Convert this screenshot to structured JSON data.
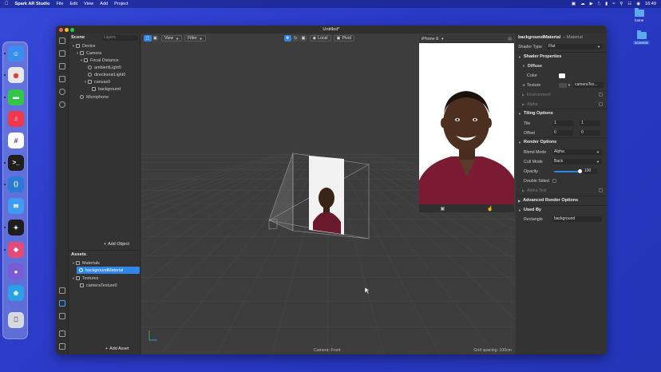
{
  "menubar": {
    "app_name": "Spark AR Studio",
    "menus": [
      "File",
      "Edit",
      "View",
      "Add",
      "Project"
    ],
    "clock": "16:49"
  },
  "desktop": {
    "icons": [
      {
        "label": "home"
      },
      {
        "label": "screenie"
      }
    ]
  },
  "dock": {
    "apps": [
      {
        "icon": "finder-icon",
        "color": "#3a8ef0"
      },
      {
        "icon": "chrome-icon",
        "color": "#e9e9e9"
      },
      {
        "icon": "messages-icon",
        "color": "#33c748"
      },
      {
        "icon": "music-icon",
        "color": "#f2384d"
      },
      {
        "icon": "slack-icon",
        "color": "#ffffff"
      },
      {
        "icon": "terminal-icon",
        "color": "#1e1e1e"
      },
      {
        "icon": "vscode-icon",
        "color": "#2a7bd6"
      },
      {
        "icon": "mail-icon",
        "color": "#3d9bf3"
      },
      {
        "icon": "figma-icon",
        "color": "#1e1e1e"
      },
      {
        "icon": "spark-icon",
        "color": "#e64a7a"
      },
      {
        "icon": "marble-icon",
        "color": "#7b5cd6"
      },
      {
        "icon": "bird-icon",
        "color": "#2aa0e8"
      },
      {
        "icon": "trash-icon",
        "color": "#d6d9e2"
      }
    ]
  },
  "window": {
    "title": "Untitled*",
    "traffic_colors": [
      "#ff5f57",
      "#febc2e",
      "#28c840"
    ]
  },
  "scene": {
    "header": "Scene",
    "search_placeholder": "Layers",
    "tree": [
      {
        "label": "Device",
        "depth": 0
      },
      {
        "label": "Camera",
        "depth": 1
      },
      {
        "label": "Focal Distance",
        "depth": 2
      },
      {
        "label": "ambientLight0",
        "depth": 3
      },
      {
        "label": "directionalLight0",
        "depth": 3
      },
      {
        "label": "canvas0",
        "depth": 3
      },
      {
        "label": "background",
        "depth": 4
      },
      {
        "label": "Microphone",
        "depth": 1
      }
    ],
    "add_object": "Add Object"
  },
  "assets": {
    "header": "Assets",
    "tree": [
      {
        "label": "Materials",
        "depth": 0
      },
      {
        "label": "backgroundMaterial",
        "depth": 1,
        "selected": true
      },
      {
        "label": "Textures",
        "depth": 0
      },
      {
        "label": "cameraTexture0",
        "depth": 1
      }
    ],
    "add_asset": "Add Asset"
  },
  "viewport": {
    "view_label": "View",
    "filter_label": "Filter",
    "local_label": "Local",
    "pivot_label": "Pivot",
    "camera_label": "Camera: Front",
    "grid_label": "Grid spacing: 100cm"
  },
  "preview": {
    "device": "iPhone 8"
  },
  "inspector": {
    "name": "backgroundMaterial",
    "type": "– Material",
    "shader_type_label": "Shader Type",
    "shader_type_value": "Flat",
    "shader_properties": "Shader Properties",
    "diffuse": "Diffuse",
    "color_label": "Color",
    "texture_label": "Texture",
    "texture_value": "cameraTex...",
    "environment": "Environment",
    "alpha": "Alpha",
    "tiling_options": "Tiling Options",
    "tile_label": "Tile",
    "tile_x": "1",
    "tile_y": "1",
    "offset_label": "Offset",
    "offset_x": "0",
    "offset_y": "0",
    "render_options": "Render Options",
    "blend_mode_label": "Blend Mode",
    "blend_mode_value": "Alpha",
    "cull_mode_label": "Cull Mode",
    "cull_mode_value": "Back",
    "opacity_label": "Opacity",
    "opacity_value": "100",
    "opacity_fraction": 1.0,
    "double_sided_label": "Double Sided",
    "alpha_test": "Alpha Test",
    "advanced_render_options": "Advanced Render Options",
    "used_by": "Used By",
    "rectangle_label": "Rectangle",
    "rectangle_value": "background"
  }
}
